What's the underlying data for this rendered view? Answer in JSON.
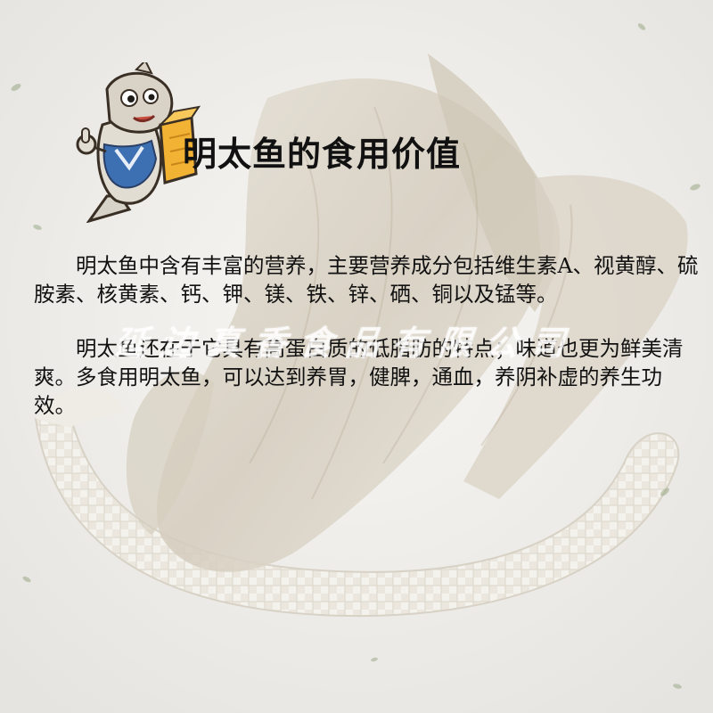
{
  "title": "明太鱼的食用价值",
  "paragraphs": [
    "明太鱼中含有丰富的营养，主要营养成分包括维生素A、视黄醇、硫胺素、核黄素、钙、钾、镁、铁、锌、硒、铜以及锰等。",
    "明太鱼还在于它具有高蛋白质的低脂肪的特点；味道也更为鲜美清爽。多食用明太鱼，可以达到养胃，健脾，通血，养阴补虚的养生功效。"
  ],
  "watermark": "延边真香食品有限公司",
  "colors": {
    "accent": "#f2b233",
    "shirt": "#3d6fb3",
    "fish": "#dcd6c9"
  }
}
